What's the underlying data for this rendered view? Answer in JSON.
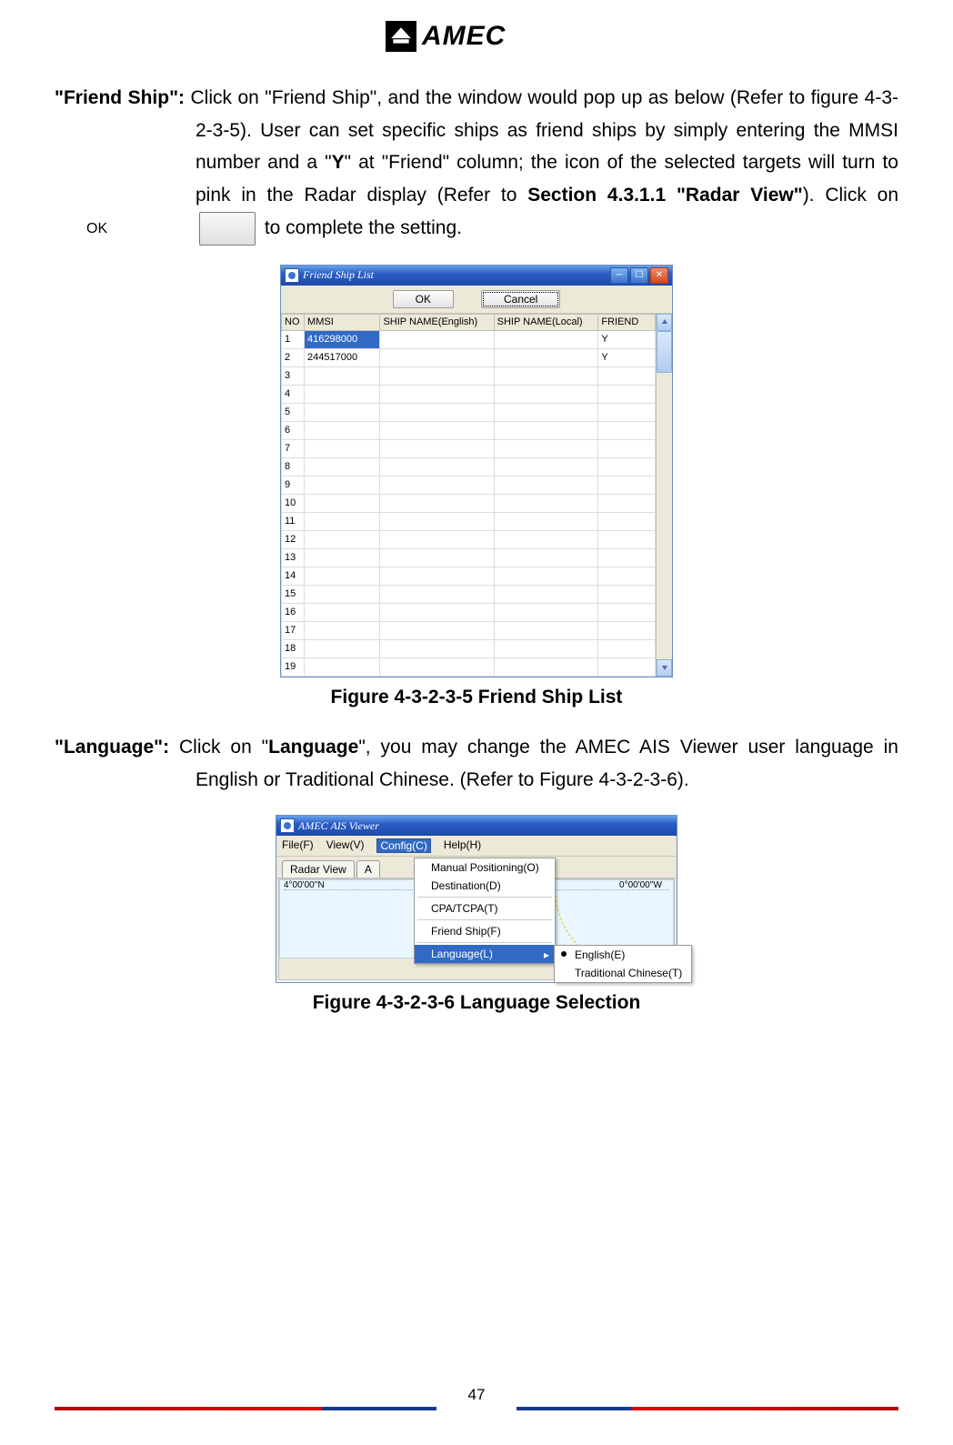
{
  "logo": {
    "text": "AMEC"
  },
  "para1": {
    "lead": "\"Friend Ship\":",
    "text_a": " Click on \"Friend Ship\", and the window would pop up as below (Refer to figure 4-3-2-3-5). User can set specific ships as friend ships by simply entering the MMSI number and a \"",
    "y": "Y",
    "text_b": "\" at \"Friend\" column; the icon of the selected targets will turn to pink in the Radar display (Refer to ",
    "sec": "Section 4.3.1.1 \"Radar View\"",
    "text_c": "). Click on ",
    "okbtn": "OK",
    "text_d": " to complete the setting."
  },
  "friendship_window": {
    "title": "Friend Ship List",
    "btn_ok": "OK",
    "btn_cancel": "Cancel",
    "headers": {
      "no": "NO",
      "mmsi": "MMSI",
      "sne": "SHIP NAME(English)",
      "snl": "SHIP NAME(Local)",
      "friend": "FRIEND"
    },
    "rows": [
      {
        "no": "1",
        "mmsi": "416298000",
        "sne": "",
        "snl": "",
        "friend": "Y",
        "selected": true
      },
      {
        "no": "2",
        "mmsi": "244517000",
        "sne": "",
        "snl": "",
        "friend": "Y"
      },
      {
        "no": "3",
        "mmsi": "",
        "sne": "",
        "snl": "",
        "friend": ""
      },
      {
        "no": "4",
        "mmsi": "",
        "sne": "",
        "snl": "",
        "friend": ""
      },
      {
        "no": "5",
        "mmsi": "",
        "sne": "",
        "snl": "",
        "friend": ""
      },
      {
        "no": "6",
        "mmsi": "",
        "sne": "",
        "snl": "",
        "friend": ""
      },
      {
        "no": "7",
        "mmsi": "",
        "sne": "",
        "snl": "",
        "friend": ""
      },
      {
        "no": "8",
        "mmsi": "",
        "sne": "",
        "snl": "",
        "friend": ""
      },
      {
        "no": "9",
        "mmsi": "",
        "sne": "",
        "snl": "",
        "friend": ""
      },
      {
        "no": "10",
        "mmsi": "",
        "sne": "",
        "snl": "",
        "friend": ""
      },
      {
        "no": "11",
        "mmsi": "",
        "sne": "",
        "snl": "",
        "friend": ""
      },
      {
        "no": "12",
        "mmsi": "",
        "sne": "",
        "snl": "",
        "friend": ""
      },
      {
        "no": "13",
        "mmsi": "",
        "sne": "",
        "snl": "",
        "friend": ""
      },
      {
        "no": "14",
        "mmsi": "",
        "sne": "",
        "snl": "",
        "friend": ""
      },
      {
        "no": "15",
        "mmsi": "",
        "sne": "",
        "snl": "",
        "friend": ""
      },
      {
        "no": "16",
        "mmsi": "",
        "sne": "",
        "snl": "",
        "friend": ""
      },
      {
        "no": "17",
        "mmsi": "",
        "sne": "",
        "snl": "",
        "friend": ""
      },
      {
        "no": "18",
        "mmsi": "",
        "sne": "",
        "snl": "",
        "friend": ""
      },
      {
        "no": "19",
        "mmsi": "",
        "sne": "",
        "snl": "",
        "friend": ""
      }
    ]
  },
  "caption1": "Figure 4-3-2-3-5 Friend Ship List",
  "para2": {
    "lead": "\"Language\":",
    "text_a": " Click on \"",
    "lang": "Language",
    "text_b": "\", you may change the AMEC AIS Viewer user language in English or Traditional Chinese. (Refer to Figure 4-3-2-3-6)."
  },
  "lang_window": {
    "title": "AMEC AIS Viewer",
    "menus": {
      "file": "File(F)",
      "view": "View(V)",
      "config": "Config(C)",
      "help": "Help(H)"
    },
    "tabs": {
      "radar": "Radar View",
      "a": "A"
    },
    "coord_left": "4°00'00''N",
    "coord_right": "0°00'00''W",
    "items": {
      "manual": "Manual Positioning(O)",
      "dest": "Destination(D)",
      "cpa": "CPA/TCPA(T)",
      "fship": "Friend Ship(F)",
      "lang": "Language(L)"
    },
    "sub": {
      "en": "English(E)",
      "tc": "Traditional Chinese(T)"
    }
  },
  "caption2": "Figure 4-3-2-3-6 Language Selection",
  "page_number": "47"
}
